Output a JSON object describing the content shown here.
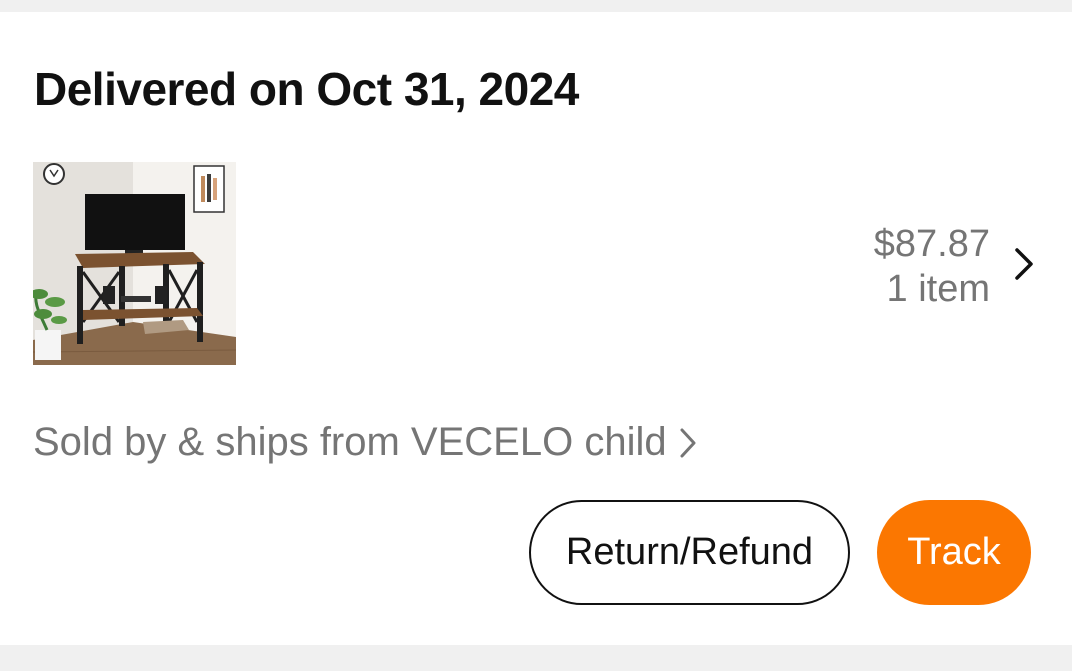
{
  "order": {
    "status_title": "Delivered on Oct 31, 2024",
    "product_image_icon": "corner-tv-stand-image",
    "price": "$87.87",
    "item_count": "1 item",
    "seller_text": "Sold by & ships from VECELO child"
  },
  "actions": {
    "return_label": "Return/Refund",
    "track_label": "Track"
  },
  "colors": {
    "accent": "#fb7701",
    "muted_text": "#757575",
    "title_text": "#111111",
    "page_background": "#f0f0f0"
  }
}
